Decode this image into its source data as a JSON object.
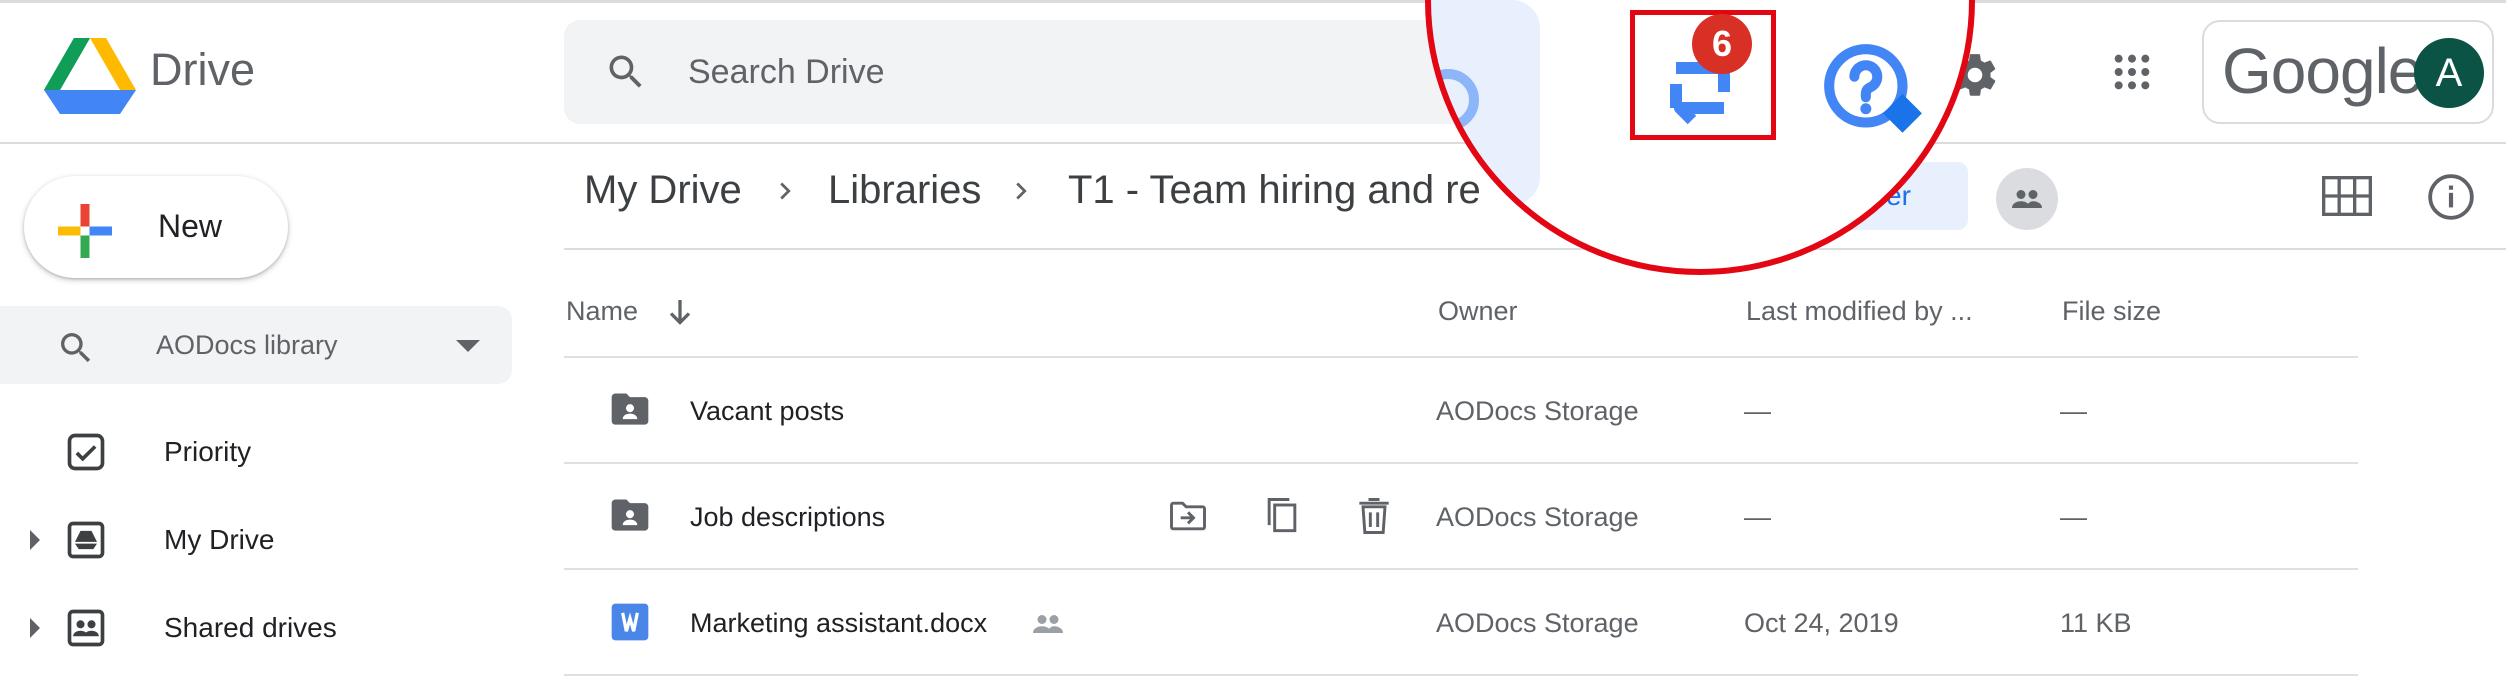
{
  "header": {
    "app_title": "Drive",
    "search_placeholder": "Search Drive",
    "account_brand": "Google",
    "avatar_initial": "A"
  },
  "sidebar": {
    "new_label": "New",
    "library_selector": "AODocs library",
    "items": [
      {
        "label": "Priority",
        "icon": "priority-checkbox-icon"
      },
      {
        "label": "My Drive",
        "icon": "my-drive-icon"
      },
      {
        "label": "Shared drives",
        "icon": "shared-drives-icon"
      }
    ]
  },
  "breadcrumb": [
    "My Drive",
    "Libraries",
    "T1 - Team hiring and re"
  ],
  "toolbar": {
    "share_label": "er"
  },
  "table": {
    "columns": [
      "Name",
      "Owner",
      "Last modified by ...",
      "File size"
    ],
    "rows": [
      {
        "name": "Vacant posts",
        "owner": "AODocs Storage",
        "modified": "—",
        "size": "—",
        "icon": "shared-folder-icon"
      },
      {
        "name": "Job descriptions",
        "owner": "AODocs Storage",
        "modified": "—",
        "size": "—",
        "icon": "shared-folder-icon"
      },
      {
        "name": "Marketing assistant.docx",
        "owner": "AODocs Storage",
        "modified": "Oct 24, 2019",
        "size": "11 KB",
        "icon": "word-doc-icon"
      }
    ]
  },
  "zoom_callout": {
    "badge_count": "6",
    "highlight_color": "#e30613",
    "icons": [
      "sync-icon",
      "help-diamond-icon"
    ]
  },
  "colors": {
    "accent_blue": "#1a73e8",
    "icon_blue": "#4285f4",
    "red": "#e30613",
    "badge_red": "#d93025",
    "avatar_green": "#0b5345"
  }
}
